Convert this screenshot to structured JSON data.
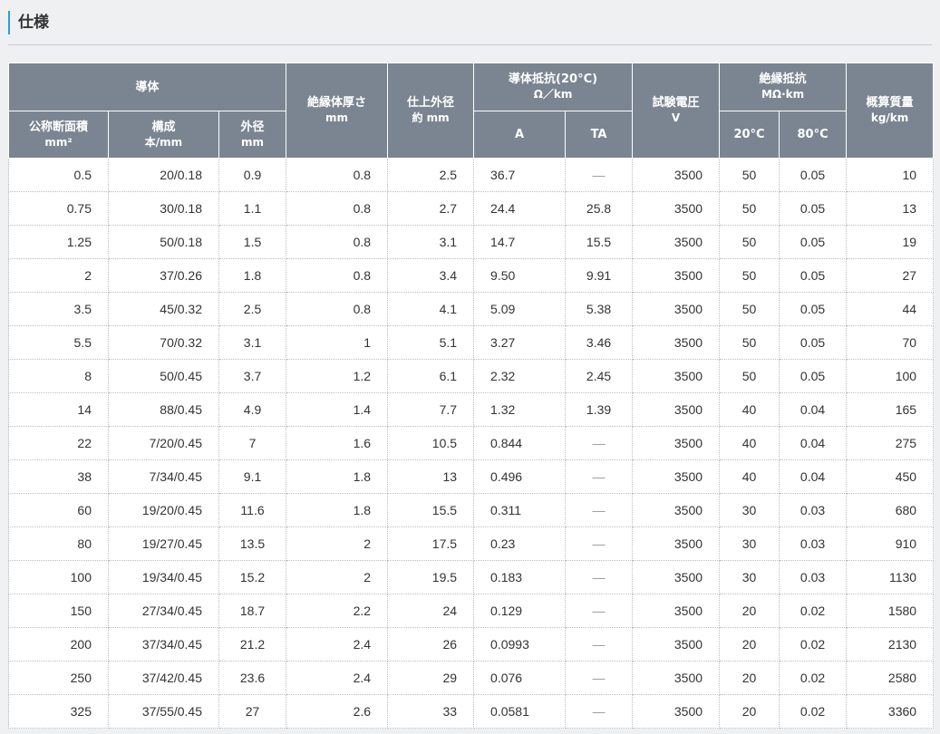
{
  "section": {
    "title": "仕様"
  },
  "table": {
    "header": {
      "conductor": "導体",
      "nominal_area": "公称断面積",
      "nominal_area_unit": "mm²",
      "composition": "構成",
      "composition_unit": "本/mm",
      "outer_diameter": "外径",
      "outer_diameter_unit": "mm",
      "insulation_thickness": "絶縁体厚さ",
      "insulation_thickness_unit": "mm",
      "finished_diameter": "仕上外径",
      "finished_diameter_unit": "約 mm",
      "conductor_resistance": "導体抵抗(20°C)",
      "conductor_resistance_unit": "Ω／km",
      "res_a": "A",
      "res_ta": "TA",
      "test_voltage": "試験電圧",
      "test_voltage_unit": "V",
      "insulation_resistance": "絶縁抵抗",
      "insulation_resistance_unit": "MΩ·km",
      "ir_20": "20°C",
      "ir_80": "80°C",
      "mass": "概算質量",
      "mass_unit": "kg/km"
    },
    "rows": [
      [
        "0.5",
        "20/0.18",
        "0.9",
        "0.8",
        "2.5",
        "36.7",
        "—",
        "3500",
        "50",
        "0.05",
        "10"
      ],
      [
        "0.75",
        "30/0.18",
        "1.1",
        "0.8",
        "2.7",
        "24.4",
        "25.8",
        "3500",
        "50",
        "0.05",
        "13"
      ],
      [
        "1.25",
        "50/0.18",
        "1.5",
        "0.8",
        "3.1",
        "14.7",
        "15.5",
        "3500",
        "50",
        "0.05",
        "19"
      ],
      [
        "2",
        "37/0.26",
        "1.8",
        "0.8",
        "3.4",
        "9.50",
        "9.91",
        "3500",
        "50",
        "0.05",
        "27"
      ],
      [
        "3.5",
        "45/0.32",
        "2.5",
        "0.8",
        "4.1",
        "5.09",
        "5.38",
        "3500",
        "50",
        "0.05",
        "44"
      ],
      [
        "5.5",
        "70/0.32",
        "3.1",
        "1",
        "5.1",
        "3.27",
        "3.46",
        "3500",
        "50",
        "0.05",
        "70"
      ],
      [
        "8",
        "50/0.45",
        "3.7",
        "1.2",
        "6.1",
        "2.32",
        "2.45",
        "3500",
        "50",
        "0.05",
        "100"
      ],
      [
        "14",
        "88/0.45",
        "4.9",
        "1.4",
        "7.7",
        "1.32",
        "1.39",
        "3500",
        "40",
        "0.04",
        "165"
      ],
      [
        "22",
        "7/20/0.45",
        "7",
        "1.6",
        "10.5",
        "0.844",
        "—",
        "3500",
        "40",
        "0.04",
        "275"
      ],
      [
        "38",
        "7/34/0.45",
        "9.1",
        "1.8",
        "13",
        "0.496",
        "—",
        "3500",
        "40",
        "0.04",
        "450"
      ],
      [
        "60",
        "19/20/0.45",
        "11.6",
        "1.8",
        "15.5",
        "0.311",
        "—",
        "3500",
        "30",
        "0.03",
        "680"
      ],
      [
        "80",
        "19/27/0.45",
        "13.5",
        "2",
        "17.5",
        "0.23",
        "—",
        "3500",
        "30",
        "0.03",
        "910"
      ],
      [
        "100",
        "19/34/0.45",
        "15.2",
        "2",
        "19.5",
        "0.183",
        "—",
        "3500",
        "30",
        "0.03",
        "1130"
      ],
      [
        "150",
        "27/34/0.45",
        "18.7",
        "2.2",
        "24",
        "0.129",
        "—",
        "3500",
        "20",
        "0.02",
        "1580"
      ],
      [
        "200",
        "37/34/0.45",
        "21.2",
        "2.4",
        "26",
        "0.0993",
        "—",
        "3500",
        "20",
        "0.02",
        "2130"
      ],
      [
        "250",
        "37/42/0.45",
        "23.6",
        "2.4",
        "29",
        "0.076",
        "—",
        "3500",
        "20",
        "0.02",
        "2580"
      ],
      [
        "325",
        "37/55/0.45",
        "27",
        "2.6",
        "33",
        "0.0581",
        "—",
        "3500",
        "20",
        "0.02",
        "3360"
      ]
    ]
  }
}
